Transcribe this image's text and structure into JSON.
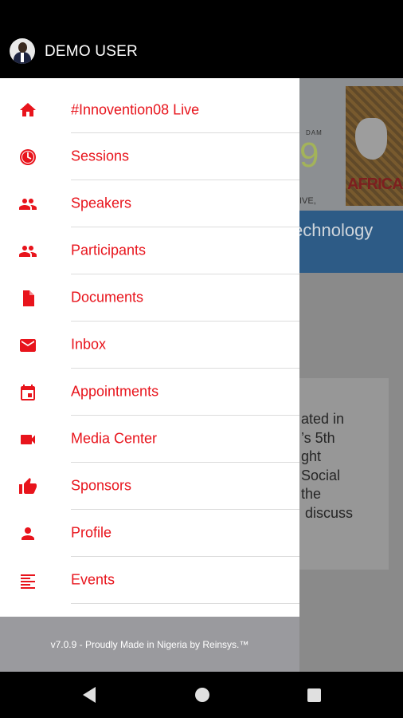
{
  "header": {
    "user_name": "DEMO USER"
  },
  "background": {
    "banner_prefix": "9",
    "banner_small_top": "DAM",
    "banner_small_bottom": "IVE,",
    "poster_text": "AFRICA",
    "blue_bar_text": "echnology",
    "card_text": "ated in\n’s 5th\nght\nSocial\nthe\n discuss"
  },
  "menu": {
    "items": [
      {
        "label": "#Innovention08 Live",
        "icon": "home-icon"
      },
      {
        "label": "Sessions",
        "icon": "clock-icon"
      },
      {
        "label": "Speakers",
        "icon": "people-icon"
      },
      {
        "label": "Participants",
        "icon": "people-icon"
      },
      {
        "label": "Documents",
        "icon": "document-icon"
      },
      {
        "label": "Inbox",
        "icon": "mail-icon"
      },
      {
        "label": "Appointments",
        "icon": "calendar-icon"
      },
      {
        "label": "Media Center",
        "icon": "video-camera-icon"
      },
      {
        "label": "Sponsors",
        "icon": "thumbs-up-icon"
      },
      {
        "label": "Profile",
        "icon": "person-icon"
      },
      {
        "label": "Events",
        "icon": "list-icon"
      }
    ]
  },
  "footer": {
    "text": "v7.0.9 - Proudly Made in Nigeria by Reinsys.™"
  },
  "colors": {
    "accent": "#e8141c",
    "header_bg": "#000000",
    "footer_bg": "#9a9a9e"
  }
}
